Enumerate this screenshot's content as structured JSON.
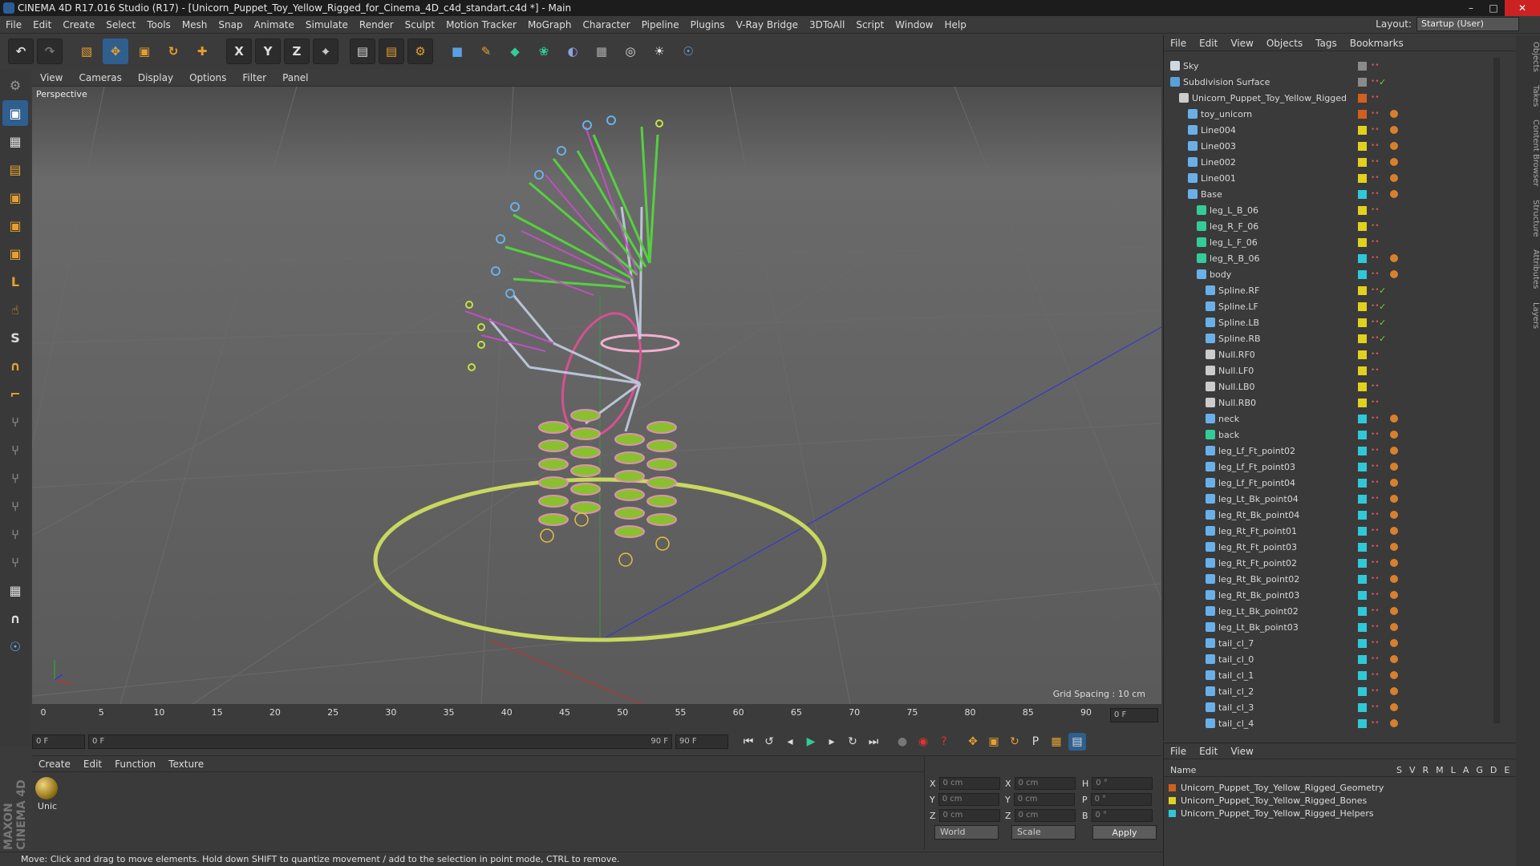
{
  "window": {
    "title": "CINEMA 4D R17.016 Studio (R17) - [Unicorn_Puppet_Toy_Yellow_Rigged_for_Cinema_4D_c4d_standart.c4d *] - Main"
  },
  "menu": [
    "File",
    "Edit",
    "Create",
    "Select",
    "Tools",
    "Mesh",
    "Snap",
    "Animate",
    "Simulate",
    "Render",
    "Sculpt",
    "Motion Tracker",
    "MoGraph",
    "Character",
    "Pipeline",
    "Plugins",
    "V-Ray Bridge",
    "3DToAll",
    "Script",
    "Window",
    "Help"
  ],
  "layout": {
    "label": "Layout:",
    "value": "Startup (User)"
  },
  "viewport": {
    "menu": [
      "View",
      "Cameras",
      "Display",
      "Options",
      "Filter",
      "Panel"
    ],
    "label": "Perspective",
    "grid_spacing": "Grid Spacing : 10 cm"
  },
  "timeline": {
    "ticks": [
      "0",
      "5",
      "10",
      "15",
      "20",
      "25",
      "30",
      "35",
      "40",
      "45",
      "50",
      "55",
      "60",
      "65",
      "70",
      "75",
      "80",
      "85",
      "90"
    ],
    "end_field": "0 F"
  },
  "playback": {
    "start": "0 F",
    "range_start": "0 F",
    "range_end": "90 F",
    "end": "90 F"
  },
  "material": {
    "menu": [
      "Create",
      "Edit",
      "Function",
      "Texture"
    ],
    "item_label": "Unic"
  },
  "coords": {
    "x": "0 cm",
    "y": "0 cm",
    "z": "0 cm",
    "sx": "0 cm",
    "sy": "0 cm",
    "sz": "0 cm",
    "h": "0 °",
    "p": "0 °",
    "b": "0 °",
    "mode1": "World",
    "mode2": "Scale",
    "apply": "Apply"
  },
  "status": "Move: Click and drag to move elements. Hold down SHIFT to quantize movement / add to the selection in point mode, CTRL to remove.",
  "object_manager": {
    "menu": [
      "File",
      "Edit",
      "View",
      "Objects",
      "Tags",
      "Bookmarks"
    ],
    "rows": [
      {
        "name": "Sky",
        "indent": 0,
        "color": "#8a8a8a",
        "icon": "#cfd8e0"
      },
      {
        "name": "Subdivision Surface",
        "indent": 0,
        "color": "#8a8a8a",
        "icon": "#5aa0d8",
        "check": "✓"
      },
      {
        "name": "Unicorn_Puppet_Toy_Yellow_Rigged",
        "indent": 1,
        "color": "#d06020",
        "icon": "#ccc"
      },
      {
        "name": "toy_unicorn",
        "indent": 2,
        "color": "#d06020",
        "icon": "#6ab0e8"
      },
      {
        "name": "Line004",
        "indent": 2,
        "color": "#e0d020",
        "icon": "#6ab0e8"
      },
      {
        "name": "Line003",
        "indent": 2,
        "color": "#e0d020",
        "icon": "#6ab0e8"
      },
      {
        "name": "Line002",
        "indent": 2,
        "color": "#e0d020",
        "icon": "#6ab0e8"
      },
      {
        "name": "Line001",
        "indent": 2,
        "color": "#e0d020",
        "icon": "#6ab0e8"
      },
      {
        "name": "Base",
        "indent": 2,
        "color": "#30c8d8",
        "icon": "#6ab0e8"
      },
      {
        "name": "leg_L_B_06",
        "indent": 3,
        "color": "#e0d020",
        "icon": "#3c9"
      },
      {
        "name": "leg_R_F_06",
        "indent": 3,
        "color": "#e0d020",
        "icon": "#3c9"
      },
      {
        "name": "leg_L_F_06",
        "indent": 3,
        "color": "#e0d020",
        "icon": "#3c9"
      },
      {
        "name": "leg_R_B_06",
        "indent": 3,
        "color": "#30c8d8",
        "icon": "#3c9"
      },
      {
        "name": "body",
        "indent": 3,
        "color": "#30c8d8",
        "icon": "#6ab0e8"
      },
      {
        "name": "Spline.RF",
        "indent": 4,
        "color": "#e0d020",
        "icon": "#6ab0e8",
        "check": "✓"
      },
      {
        "name": "Spline.LF",
        "indent": 4,
        "color": "#e0d020",
        "icon": "#6ab0e8",
        "check": "✓"
      },
      {
        "name": "Spline.LB",
        "indent": 4,
        "color": "#e0d020",
        "icon": "#6ab0e8",
        "check": "✓"
      },
      {
        "name": "Spline.RB",
        "indent": 4,
        "color": "#e0d020",
        "icon": "#6ab0e8",
        "check": "✓"
      },
      {
        "name": "Null.RF0",
        "indent": 4,
        "color": "#e0d020",
        "icon": "#ccc"
      },
      {
        "name": "Null.LF0",
        "indent": 4,
        "color": "#e0d020",
        "icon": "#ccc"
      },
      {
        "name": "Null.LB0",
        "indent": 4,
        "color": "#e0d020",
        "icon": "#ccc"
      },
      {
        "name": "Null.RB0",
        "indent": 4,
        "color": "#e0d020",
        "icon": "#ccc"
      },
      {
        "name": "neck",
        "indent": 4,
        "color": "#30c8d8",
        "icon": "#6ab0e8"
      },
      {
        "name": "back",
        "indent": 4,
        "color": "#30c8d8",
        "icon": "#3c9"
      },
      {
        "name": "leg_Lf_Ft_point02",
        "indent": 4,
        "color": "#30c8d8",
        "icon": "#6ab0e8"
      },
      {
        "name": "leg_Lf_Ft_point03",
        "indent": 4,
        "color": "#30c8d8",
        "icon": "#6ab0e8"
      },
      {
        "name": "leg_Lf_Ft_point04",
        "indent": 4,
        "color": "#30c8d8",
        "icon": "#6ab0e8"
      },
      {
        "name": "leg_Lt_Bk_point04",
        "indent": 4,
        "color": "#30c8d8",
        "icon": "#6ab0e8"
      },
      {
        "name": "leg_Rt_Bk_point04",
        "indent": 4,
        "color": "#30c8d8",
        "icon": "#6ab0e8"
      },
      {
        "name": "leg_Rt_Ft_point01",
        "indent": 4,
        "color": "#30c8d8",
        "icon": "#6ab0e8"
      },
      {
        "name": "leg_Rt_Ft_point03",
        "indent": 4,
        "color": "#30c8d8",
        "icon": "#6ab0e8"
      },
      {
        "name": "leg_Rt_Ft_point02",
        "indent": 4,
        "color": "#30c8d8",
        "icon": "#6ab0e8"
      },
      {
        "name": "leg_Rt_Bk_point02",
        "indent": 4,
        "color": "#30c8d8",
        "icon": "#6ab0e8"
      },
      {
        "name": "leg_Rt_Bk_point03",
        "indent": 4,
        "color": "#30c8d8",
        "icon": "#6ab0e8"
      },
      {
        "name": "leg_Lt_Bk_point02",
        "indent": 4,
        "color": "#30c8d8",
        "icon": "#6ab0e8"
      },
      {
        "name": "leg_Lt_Bk_point03",
        "indent": 4,
        "color": "#30c8d8",
        "icon": "#6ab0e8"
      },
      {
        "name": "tail_cl_7",
        "indent": 4,
        "color": "#30c8d8",
        "icon": "#6ab0e8"
      },
      {
        "name": "tail_cl_0",
        "indent": 4,
        "color": "#30c8d8",
        "icon": "#6ab0e8"
      },
      {
        "name": "tail_cl_1",
        "indent": 4,
        "color": "#30c8d8",
        "icon": "#6ab0e8"
      },
      {
        "name": "tail_cl_2",
        "indent": 4,
        "color": "#30c8d8",
        "icon": "#6ab0e8"
      },
      {
        "name": "tail_cl_3",
        "indent": 4,
        "color": "#30c8d8",
        "icon": "#6ab0e8"
      },
      {
        "name": "tail_cl_4",
        "indent": 4,
        "color": "#30c8d8",
        "icon": "#6ab0e8"
      }
    ]
  },
  "layer_manager": {
    "menu": [
      "File",
      "Edit",
      "View"
    ],
    "header": {
      "name": "Name",
      "cols": [
        "S",
        "V",
        "R",
        "M",
        "L",
        "A",
        "G",
        "D",
        "E"
      ]
    },
    "layers": [
      {
        "name": "Unicorn_Puppet_Toy_Yellow_Rigged_Geometry",
        "color": "#d06020"
      },
      {
        "name": "Unicorn_Puppet_Toy_Yellow_Rigged_Bones",
        "color": "#e0d020"
      },
      {
        "name": "Unicorn_Puppet_Toy_Yellow_Rigged_Helpers",
        "color": "#30c8d8"
      }
    ]
  },
  "side_tabs": [
    "Objects",
    "Takes",
    "Content Browser",
    "Structure",
    "Attributes",
    "Layers"
  ],
  "logo": "MAXON CINEMA 4D"
}
